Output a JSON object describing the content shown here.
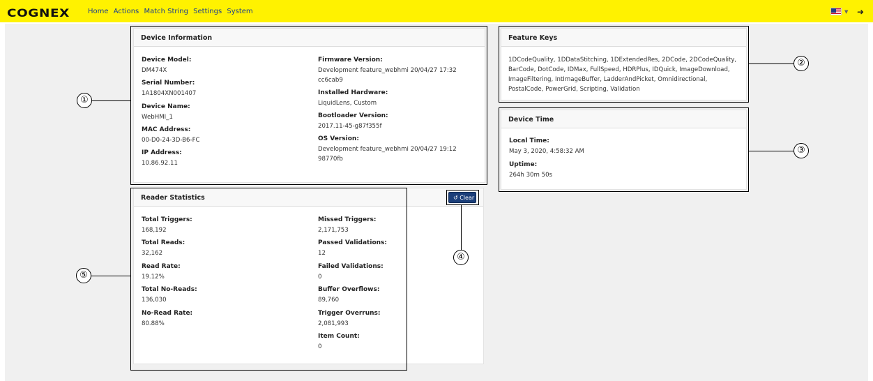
{
  "header": {
    "logo": "COGNEX",
    "nav": [
      "Home",
      "Actions",
      "Match String",
      "Settings",
      "System"
    ]
  },
  "device_info": {
    "title": "Device Information",
    "left": [
      {
        "label": "Device Model:",
        "value": "DM474X"
      },
      {
        "label": "Serial Number:",
        "value": "1A1804XN001407"
      },
      {
        "label": "Device Name:",
        "value": "WebHMI_1"
      },
      {
        "label": "MAC Address:",
        "value": "00-D0-24-3D-B6-FC"
      },
      {
        "label": "IP Address:",
        "value": "10.86.92.11"
      }
    ],
    "firmware_label": "Firmware Version:",
    "firmware_line1": "Development feature_webhmi 20/04/27 17:32",
    "firmware_line2": "cc6cab9",
    "hardware_label": "Installed Hardware:",
    "hardware_value": "LiquidLens, Custom",
    "bootloader_label": "Bootloader Version:",
    "bootloader_value": "2017.11-45-g87f355f",
    "os_label": "OS Version:",
    "os_line1": "Development feature_webhmi 20/04/27 19:12",
    "os_line2": "98770fb"
  },
  "feature_keys": {
    "title": "Feature Keys",
    "line1": "1DCodeQuality, 1DDataStitching, 1DExtendedRes, 2DCode, 2DCodeQuality,",
    "line2": "BarCode, DotCode, IDMax, FullSpeed, HDRPlus, IDQuick, ImageDownload,",
    "line3": "ImageFiltering, IntImageBuffer, LadderAndPicket, Omnidirectional,",
    "line4": "PostalCode, PowerGrid, Scripting, Validation"
  },
  "device_time": {
    "title": "Device Time",
    "local_label": "Local Time:",
    "local_value": "May 3, 2020, 4:58:32 AM",
    "uptime_label": "Uptime:",
    "uptime_value": "264h 30m 50s"
  },
  "reader_stats": {
    "title": "Reader Statistics",
    "clear_label": "Clear",
    "left": [
      {
        "label": "Total Triggers:",
        "value": "168,192"
      },
      {
        "label": "Total Reads:",
        "value": "32,162"
      },
      {
        "label": "Read Rate:",
        "value": "19.12%"
      },
      {
        "label": "Total No-Reads:",
        "value": "136,030"
      },
      {
        "label": "No-Read Rate:",
        "value": "80.88%"
      }
    ],
    "right": [
      {
        "label": "Missed Triggers:",
        "value": "2,171,753"
      },
      {
        "label": "Passed Validations:",
        "value": "12"
      },
      {
        "label": "Failed Validations:",
        "value": "0"
      },
      {
        "label": "Buffer Overflows:",
        "value": "89,760"
      },
      {
        "label": "Trigger Overruns:",
        "value": "2,081,993"
      },
      {
        "label": "Item Count:",
        "value": "0"
      }
    ]
  },
  "callouts": [
    "①",
    "②",
    "③",
    "④",
    "⑤"
  ]
}
